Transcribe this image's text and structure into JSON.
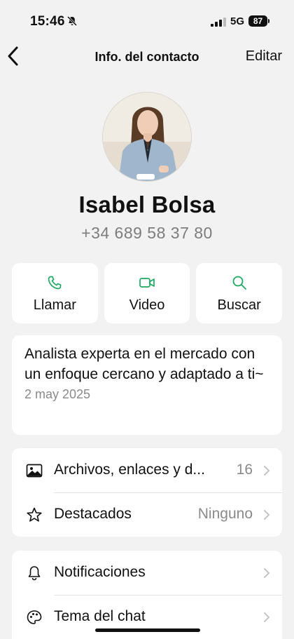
{
  "status_bar": {
    "time": "15:46",
    "network": "5G",
    "battery": "87"
  },
  "nav": {
    "title": "Info. del contacto",
    "edit_label": "Editar"
  },
  "contact": {
    "name": "Isabel Bolsa",
    "phone": "+34 689 58 37 80"
  },
  "actions": [
    {
      "label": "Llamar",
      "icon": "phone-icon"
    },
    {
      "label": "Video",
      "icon": "video-icon"
    },
    {
      "label": "Buscar",
      "icon": "search-icon"
    }
  ],
  "about": {
    "text": "Analista experta en el mercado con un enfoque cercano y adaptado a ti~",
    "date": "2 may 2025"
  },
  "media_section": {
    "items": [
      {
        "label": "Archivos, enlaces y d...",
        "value": "16",
        "icon": "image-icon"
      },
      {
        "label": "Destacados",
        "value": "Ninguno",
        "icon": "star-icon"
      }
    ]
  },
  "settings_section": {
    "items": [
      {
        "label": "Notificaciones",
        "icon": "bell-icon"
      },
      {
        "label": "Tema del chat",
        "icon": "palette-icon"
      }
    ]
  },
  "colors": {
    "background": "#f2f2f2",
    "card": "#ffffff",
    "accent": "#1daa61",
    "secondary_text": "#8a8a8a"
  }
}
